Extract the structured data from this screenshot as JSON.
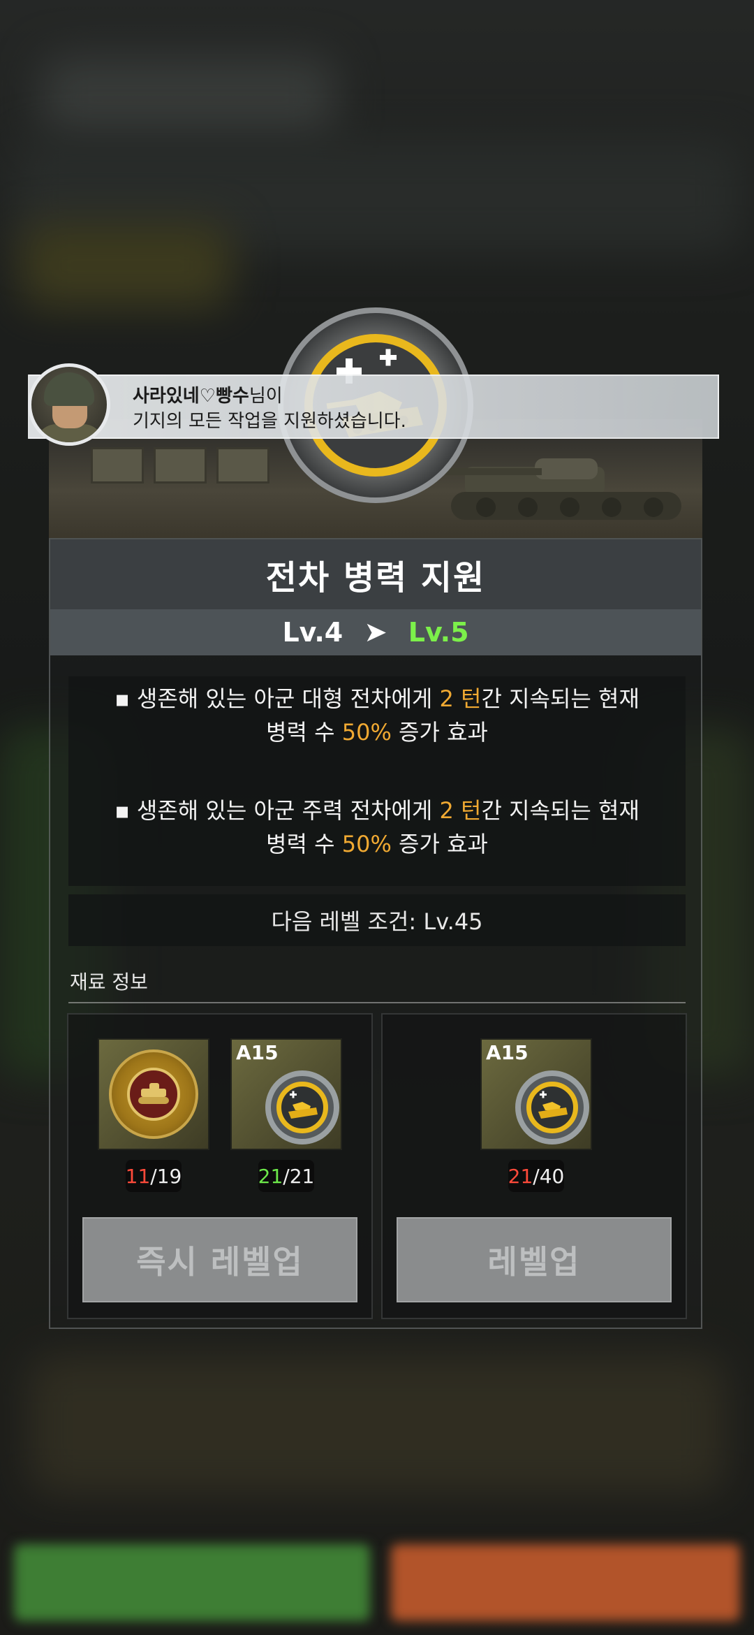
{
  "notification": {
    "player_name": "사라있네♡빵수",
    "name_suffix": "님이",
    "message": "기지의 모든 작업을 지원하셨습니다."
  },
  "skill": {
    "title": "전차 병력 지원",
    "current_level": "Lv.4",
    "next_level": "Lv.5",
    "level_arrow": "➤",
    "icon": "tank-plus-icon"
  },
  "effects": [
    {
      "prefix": "생존해 있는 아군 대형 전차에게 ",
      "turns": "2 턴",
      "middle": "간 지속되는 현재",
      "line2_prefix": "병력 수 ",
      "percent": "50%",
      "suffix": " 증가 효과"
    },
    {
      "prefix": "생존해 있는 아군 주력 전차에게 ",
      "turns": "2 턴",
      "middle": "간 지속되는 현재",
      "line2_prefix": "병력 수 ",
      "percent": "50%",
      "suffix": " 증가 효과"
    }
  ],
  "next_condition": "다음 레벨 조건: Lv.45",
  "materials_label": "재료 정보",
  "materials": {
    "instant": [
      {
        "icon": "tank-medal-icon",
        "have": "11",
        "need": "/19",
        "status": "insufficient"
      },
      {
        "icon": "tank-support-token-icon",
        "code": "A15",
        "have": "21",
        "need": "/21",
        "status": "sufficient"
      }
    ],
    "normal": [
      {
        "icon": "tank-support-token-icon",
        "code": "A15",
        "have": "21",
        "need": "/40",
        "status": "insufficient"
      }
    ]
  },
  "buttons": {
    "instant_levelup": "즉시 레벨업",
    "levelup": "레벨업"
  },
  "colors": {
    "highlight": "#f0a932",
    "next_level": "#7cf04a",
    "insufficient": "#ff4a3a",
    "sufficient": "#6de84a"
  }
}
